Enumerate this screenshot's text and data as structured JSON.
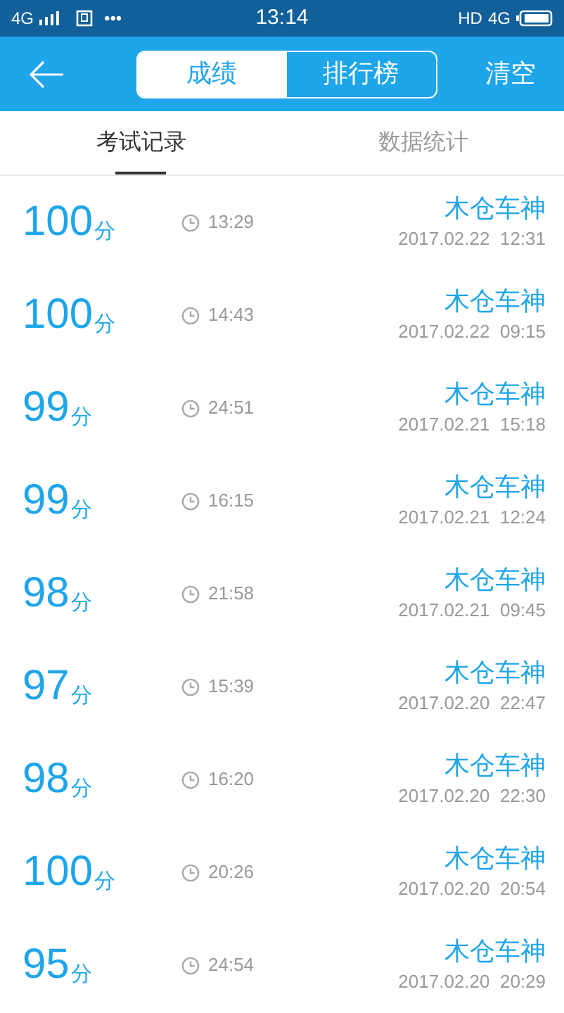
{
  "status_bar": {
    "network": "4G",
    "dots": "•••",
    "time": "13:14",
    "hd": "HD",
    "network_right": "4G"
  },
  "header": {
    "segments": [
      {
        "label": "成绩",
        "selected": true
      },
      {
        "label": "排行榜",
        "selected": false
      }
    ],
    "action": "清空"
  },
  "tabs": [
    {
      "label": "考试记录",
      "selected": true
    },
    {
      "label": "数据统计",
      "selected": false
    }
  ],
  "records": [
    {
      "score": "100",
      "unit": "分",
      "duration": "13:29",
      "name": "木仓车神",
      "date": "2017.02.22  12:31"
    },
    {
      "score": "100",
      "unit": "分",
      "duration": "14:43",
      "name": "木仓车神",
      "date": "2017.02.22  09:15"
    },
    {
      "score": "99",
      "unit": "分",
      "duration": "24:51",
      "name": "木仓车神",
      "date": "2017.02.21  15:18"
    },
    {
      "score": "99",
      "unit": "分",
      "duration": "16:15",
      "name": "木仓车神",
      "date": "2017.02.21  12:24"
    },
    {
      "score": "98",
      "unit": "分",
      "duration": "21:58",
      "name": "木仓车神",
      "date": "2017.02.21  09:45"
    },
    {
      "score": "97",
      "unit": "分",
      "duration": "15:39",
      "name": "木仓车神",
      "date": "2017.02.20  22:47"
    },
    {
      "score": "98",
      "unit": "分",
      "duration": "16:20",
      "name": "木仓车神",
      "date": "2017.02.20  22:30"
    },
    {
      "score": "100",
      "unit": "分",
      "duration": "20:26",
      "name": "木仓车神",
      "date": "2017.02.20  20:54"
    },
    {
      "score": "95",
      "unit": "分",
      "duration": "24:54",
      "name": "木仓车神",
      "date": "2017.02.20  20:29"
    }
  ]
}
